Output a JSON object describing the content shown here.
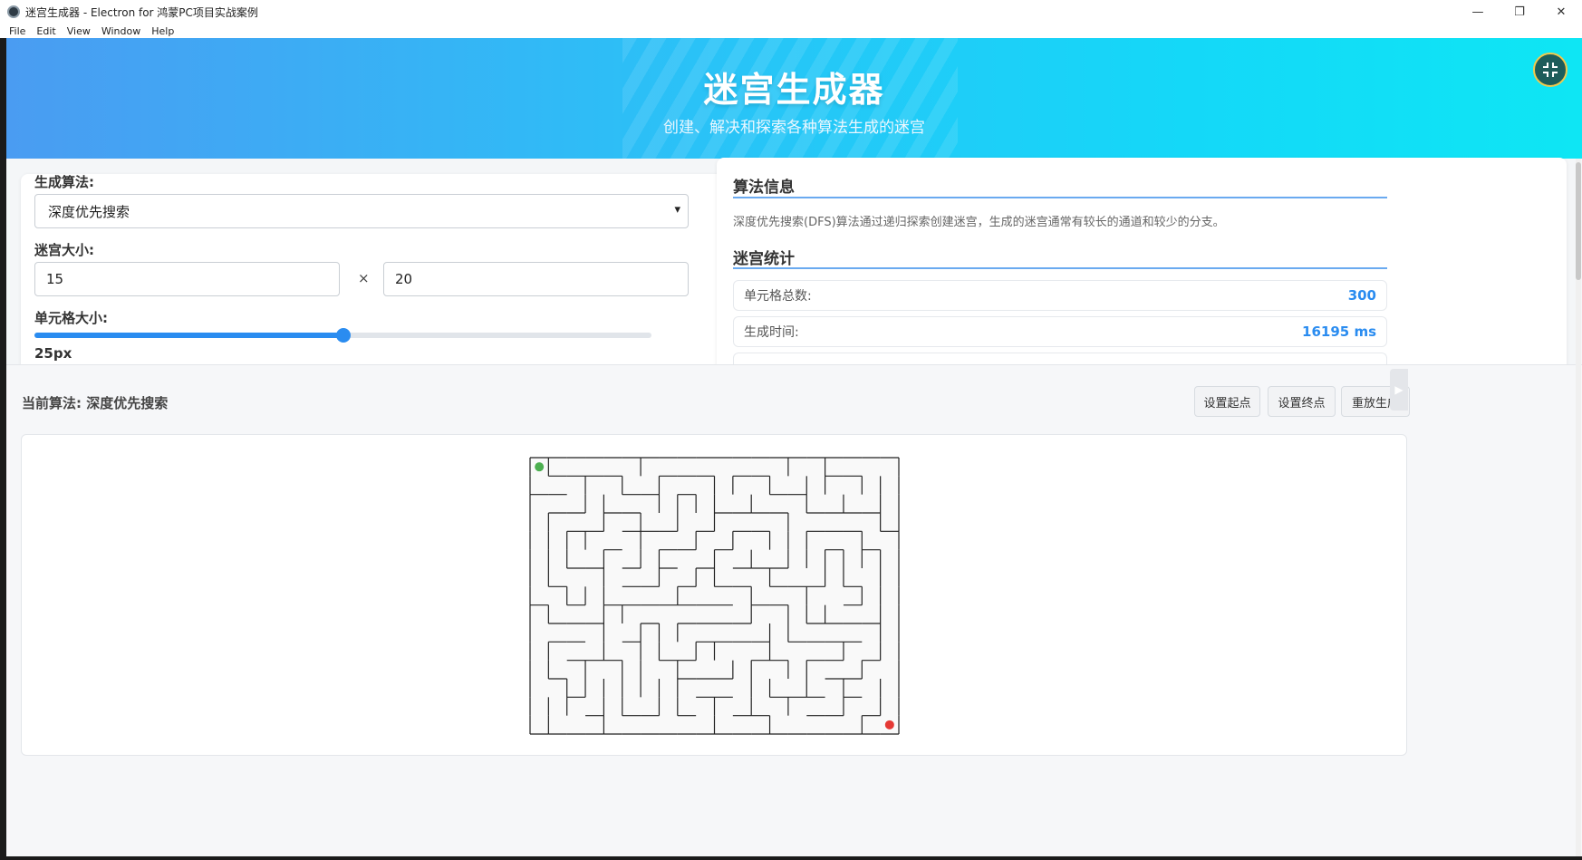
{
  "window": {
    "title": "迷宫生成器 - Electron for 鸿蒙PC项目实战案例",
    "controls": [
      "—",
      "❐",
      "✕"
    ]
  },
  "menu": [
    "File",
    "Edit",
    "View",
    "Window",
    "Help"
  ],
  "hero": {
    "title": "迷宫生成器",
    "subtitle": "创建、解决和探索各种算法生成的迷宫",
    "exit_fullscreen_icon": "compress-icon"
  },
  "controls": {
    "algorithm_label": "生成算法:",
    "algorithm_value": "深度优先搜索",
    "size_label": "迷宫大小:",
    "rows": "15",
    "cols": "20",
    "times": "×",
    "cell_label": "单元格大小:",
    "cell_value": "25px",
    "cell_slider_fraction": 0.5
  },
  "info": {
    "algo_title": "算法信息",
    "algo_text": "深度优先搜索(DFS)算法通过递归探索创建迷宫，生成的迷宫通常有较长的通道和较少的分支。",
    "stats_title": "迷宫统计",
    "stats": [
      {
        "label": "单元格总数:",
        "value": "300"
      },
      {
        "label": "生成时间:",
        "value": "16195 ms"
      }
    ]
  },
  "toolbar": {
    "current_algo": "当前算法: 深度优先搜索",
    "set_start": "设置起点",
    "set_end": "设置终点",
    "replay": "重放生成"
  },
  "maze": {
    "rows": 15,
    "cols": 20,
    "start_color": "#4caf50",
    "end_color": "#e53935",
    "wall_color": "#222222",
    "floor_color": "#f9f9f9"
  },
  "colors": {
    "accent": "#2a8cf0"
  }
}
